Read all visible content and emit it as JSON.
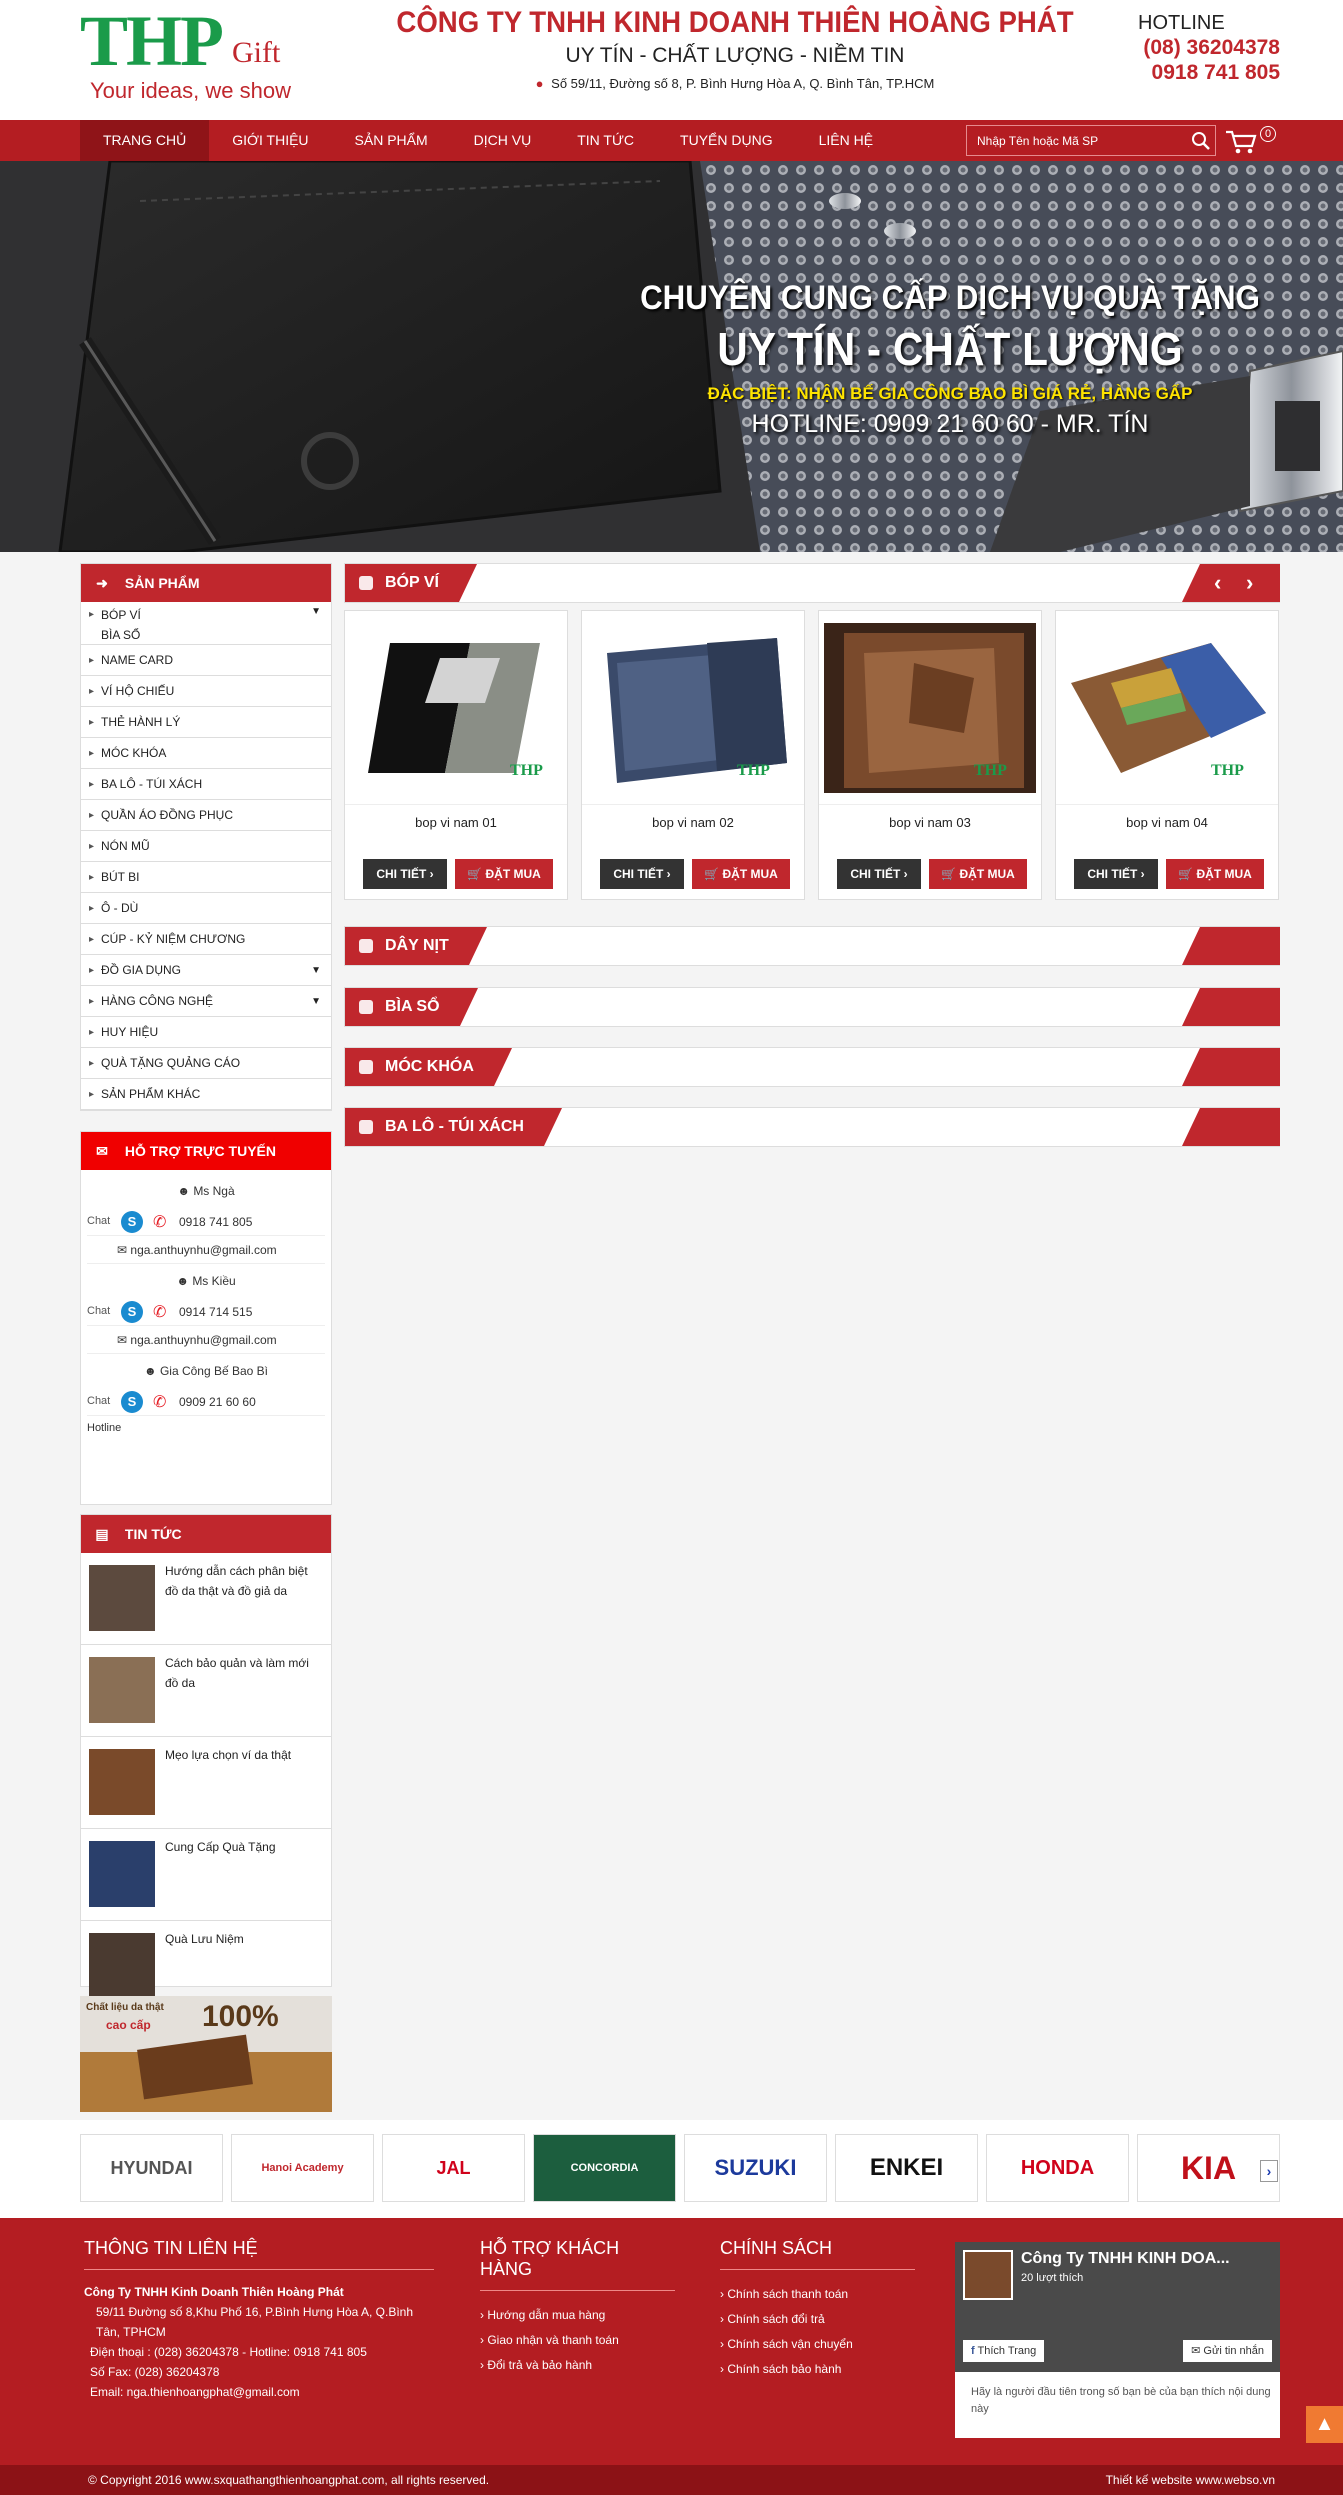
{
  "header": {
    "logo_main": "THP",
    "logo_gift": "Gift",
    "logo_slogan": "Your ideas, we show",
    "company_name": "CÔNG TY TNHH KINH DOANH THIÊN HOÀNG PHÁT",
    "motto": "UY TÍN - CHẤT LƯỢNG - NIỀM TIN",
    "address": "Số 59/11, Đường số 8, P. Bình Hưng Hòa A, Q. Bình Tân, TP.HCM",
    "hotline_label": "HOTLINE",
    "hotline_1": "(08) 36204378",
    "hotline_2": "0918 741 805"
  },
  "nav": {
    "items": [
      {
        "label": "TRANG CHỦ"
      },
      {
        "label": "GIỚI THIỆU"
      },
      {
        "label": "SẢN PHẨM"
      },
      {
        "label": "DỊCH VỤ"
      },
      {
        "label": "TIN TỨC"
      },
      {
        "label": "TUYỂN DỤNG"
      },
      {
        "label": "LIÊN HỆ"
      }
    ],
    "search_placeholder": "Nhập Tên hoặc Mã SP",
    "cart_count": "0"
  },
  "banner": {
    "line1": "CHUYÊN CUNG CẤP DỊCH VỤ QUÀ TẶNG",
    "line2": "UY TÍN - CHẤT LƯỢNG",
    "line3": "ĐẶC BIỆT: NHẬN BẾ GIA CÔNG BAO BÌ GIÁ RẺ, HÀNG GẤP",
    "line4": "HOTLINE: 0909 21 60 60 - MR. TÍN"
  },
  "sidebar": {
    "products_title": "SẢN PHẨM",
    "categories": [
      {
        "label": "BÓP VÍ"
      },
      {
        "label": "BÌA SỔ"
      },
      {
        "label": "NAME CARD"
      },
      {
        "label": "VÍ HỘ CHIẾU"
      },
      {
        "label": "THẺ HÀNH LÝ"
      },
      {
        "label": "MÓC KHÓA"
      },
      {
        "label": "BA LÔ - TÚI XÁCH"
      },
      {
        "label": "QUẦN ÁO ĐỒNG PHỤC"
      },
      {
        "label": "NÓN MŨ"
      },
      {
        "label": "BÚT BI"
      },
      {
        "label": "Ô - DÙ"
      },
      {
        "label": "CÚP - KỶ NIỆM CHƯƠNG"
      },
      {
        "label": "ĐỒ GIA DỤNG"
      },
      {
        "label": "HÀNG CÔNG NGHỆ"
      },
      {
        "label": "HUY HIỆU"
      },
      {
        "label": "QUÀ TẶNG QUẢNG CÁO"
      },
      {
        "label": "SẢN PHẨM KHÁC"
      }
    ],
    "support_title": "HỖ TRỢ TRỰC TUYẾN",
    "supporters": [
      {
        "name": "Ms Ngà",
        "phone": "0918 741 805",
        "email": "nga.anthuynhu@gmail.com",
        "chat": "Chat"
      },
      {
        "name": "Ms Kiều",
        "phone": "0914 714 515",
        "email": "nga.anthuynhu@gmail.com",
        "chat": "Chat"
      },
      {
        "name": "Gia Công Bế Bao Bì",
        "phone": "0909 21 60 60",
        "chat": "Chat"
      }
    ],
    "support_footer": "Hotline",
    "news_title": "TIN TỨC",
    "news": [
      {
        "title": "Hướng dẫn cách phân biệt đồ da thật và đồ giả da"
      },
      {
        "title": "Cách bảo quản và làm mới đồ da"
      },
      {
        "title": "Mẹo lựa chọn ví da thật"
      },
      {
        "title": "Cung Cấp Quà Tặng"
      },
      {
        "title": "Quà Lưu Niệm"
      }
    ],
    "ad_line1": "Chất liệu da thật",
    "ad_line2": "cao cấp",
    "ad_pct": "100%"
  },
  "sections": [
    {
      "title": "BÓP VÍ"
    },
    {
      "title": "DÂY NỊT"
    },
    {
      "title": "BÌA SỔ"
    },
    {
      "title": "MÓC KHÓA"
    },
    {
      "title": "BA LÔ - TÚI XÁCH"
    }
  ],
  "products": [
    {
      "name": "bop vi nam 01",
      "detail": "CHI TIẾT",
      "buy": "ĐẶT MUA"
    },
    {
      "name": "bop vi nam 02",
      "detail": "CHI TIẾT",
      "buy": "ĐẶT MUA"
    },
    {
      "name": "bop vi nam 03",
      "detail": "CHI TIẾT",
      "buy": "ĐẶT MUA"
    },
    {
      "name": "bop vi nam 04",
      "detail": "CHI TIẾT",
      "buy": "ĐẶT MUA"
    }
  ],
  "product_watermark": "THP",
  "partners": [
    {
      "name": "HYUNDAI"
    },
    {
      "name": "Hanoi Academy"
    },
    {
      "name": "JAL"
    },
    {
      "name": "CONCORDIA"
    },
    {
      "name": "SUZUKI"
    },
    {
      "name": "ENKEI"
    },
    {
      "name": "HONDA"
    },
    {
      "name": "KIA"
    }
  ],
  "footer": {
    "contact_title": "THÔNG TIN LIÊN HỆ",
    "contact_company": "Công Ty TNHH Kinh Doanh Thiên Hoàng Phát",
    "contact_address": "59/11 Đường số 8,Khu Phố 16, P.Bình Hưng Hòa A, Q.Bình Tân, TPHCM",
    "contact_phone": "Điện thoại : (028) 36204378 - Hotline: 0918 741 805",
    "contact_fax": "Số Fax: (028) 36204378",
    "contact_email": "Email: nga.thienhoangphat@gmail.com",
    "support_title": "HỖ TRỢ KHÁCH HÀNG",
    "support_links": [
      {
        "label": "Hướng dẫn mua hàng"
      },
      {
        "label": "Giao nhận và thanh toán"
      },
      {
        "label": "Đổi trả và bảo hành"
      }
    ],
    "policy_title": "CHÍNH SÁCH",
    "policy_links": [
      {
        "label": "Chính sách thanh toán"
      },
      {
        "label": "Chính sách đổi trả"
      },
      {
        "label": "Chính sách vận chuyển"
      },
      {
        "label": "Chính sách bảo hành"
      }
    ],
    "fb_page_name": "Công Ty TNHH KINH DOA...",
    "fb_likes": "20 lượt thích",
    "fb_like_btn": "Thích Trang",
    "fb_msg_btn": "Gửi tin nhắn",
    "fb_prompt": "Hãy là người đầu tiên trong số bạn bè của bạn thích nội dung này",
    "copyright": "© Copyright 2016 www.sxquathangthienhoangphat.com, all rights reserved.",
    "designer": "Thiết kế website www.webso.vn"
  },
  "colors": {
    "brand_red": "#c0272d",
    "nav_red": "#b41d22",
    "logo_green": "#1a9b4a"
  }
}
